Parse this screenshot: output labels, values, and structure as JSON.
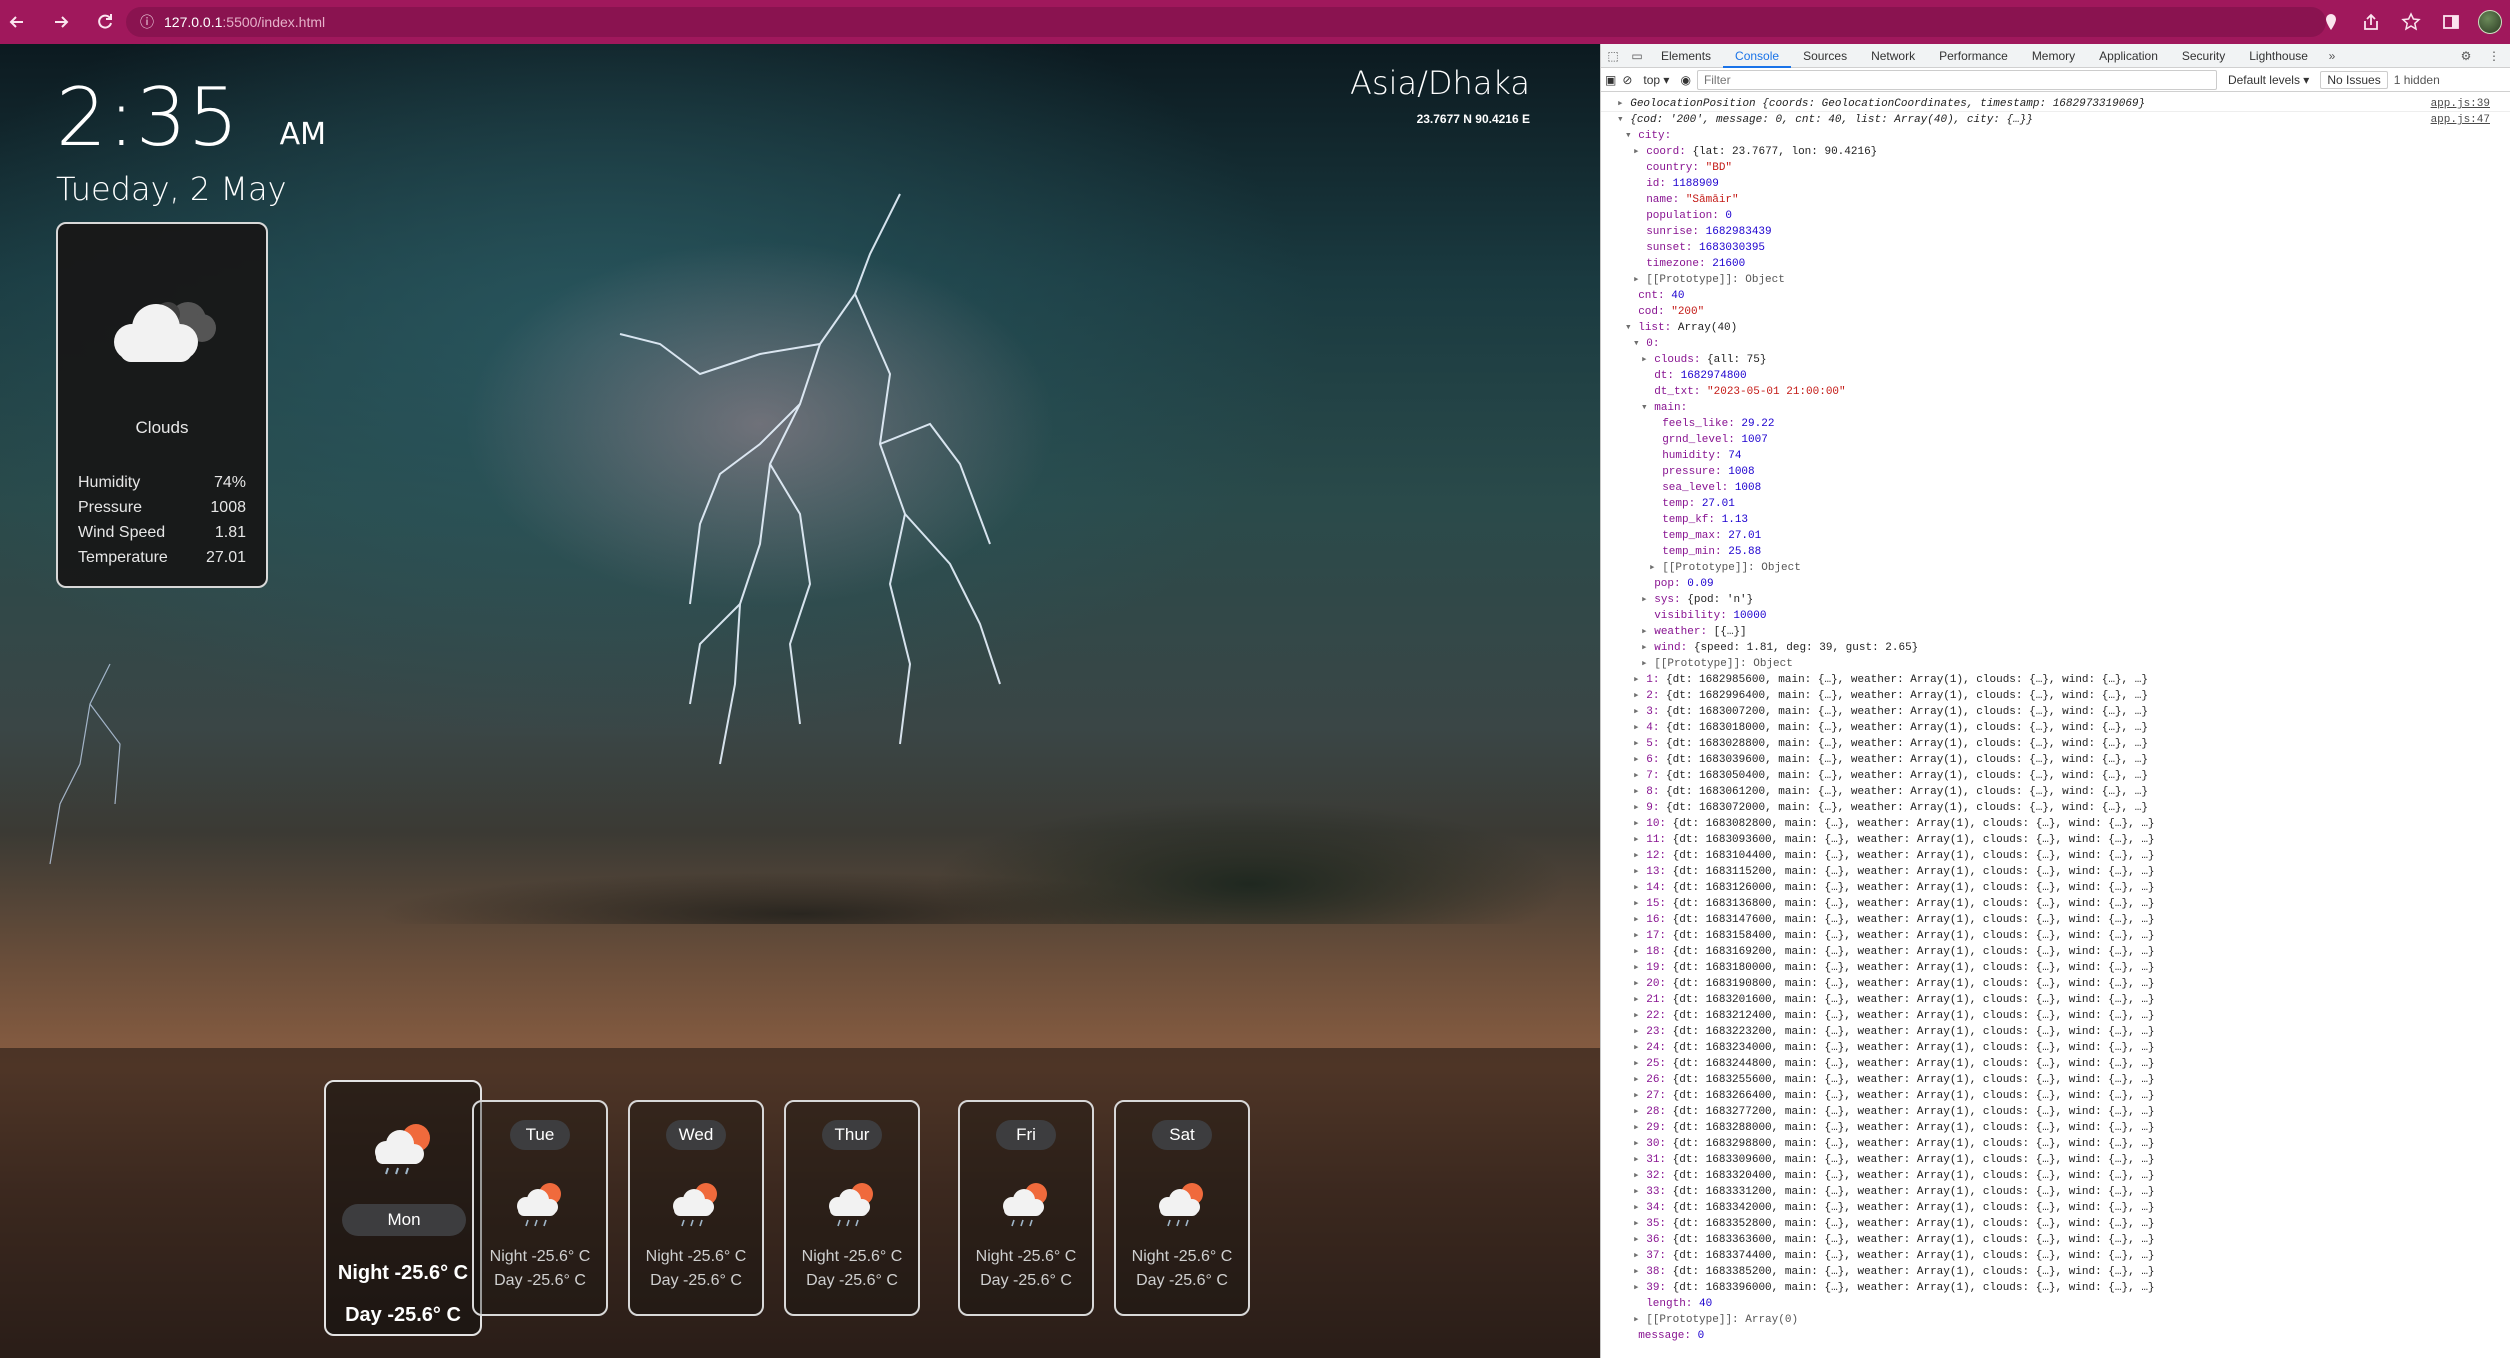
{
  "browser": {
    "url_host": "127.0.0.1",
    "url_path": ":5500/index.html"
  },
  "weather": {
    "time": "2:35",
    "ampm": "AM",
    "date": "Tueday, 2 May",
    "timezone": "Asia/Dhaka",
    "coords": "23.7677 N 90.4216 E",
    "current": {
      "condition": "Clouds",
      "stats": [
        {
          "label": "Humidity",
          "value": "74%"
        },
        {
          "label": "Pressure",
          "value": "1008"
        },
        {
          "label": "Wind Speed",
          "value": "1.81"
        },
        {
          "label": "Temperature",
          "value": "27.01"
        }
      ]
    },
    "today": {
      "day": "Mon",
      "night": "Night -25.6° C",
      "dayt": "Day -25.6° C"
    },
    "forecast": [
      {
        "day": "Tue",
        "night": "Night -25.6° C",
        "dayt": "Day -25.6° C"
      },
      {
        "day": "Wed",
        "night": "Night -25.6° C",
        "dayt": "Day -25.6° C"
      },
      {
        "day": "Thur",
        "night": "Night -25.6° C",
        "dayt": "Day -25.6° C"
      },
      {
        "day": "Fri",
        "night": "Night -25.6° C",
        "dayt": "Day -25.6° C"
      },
      {
        "day": "Sat",
        "night": "Night -25.6° C",
        "dayt": "Day -25.6° C"
      }
    ]
  },
  "devtools": {
    "tabs": [
      "Elements",
      "Console",
      "Sources",
      "Network",
      "Performance",
      "Memory",
      "Application",
      "Security",
      "Lighthouse"
    ],
    "active_tab": "Console",
    "context": "top ▾",
    "filter_placeholder": "Filter",
    "levels": "Default levels ▾",
    "issues": "No Issues",
    "hidden": "1 hidden",
    "lines": [
      {
        "indent": 1,
        "arrow": "▸",
        "text": "GeolocationPosition {coords: GeolocationCoordinates, timestamp: 1682973319069}",
        "src": "app.js:39",
        "italic": true
      },
      {
        "indent": 1,
        "arrow": "▾",
        "text": "{cod: '200', message: 0, cnt: 40, list: Array(40), city: {…}}",
        "src": "app.js:47",
        "italic": true
      },
      {
        "indent": 2,
        "arrow": "▾",
        "key": "city",
        "text": ""
      },
      {
        "indent": 3,
        "arrow": "▸",
        "key": "coord",
        "text": "{lat: 23.7677, lon: 90.4216}"
      },
      {
        "indent": 3,
        "key": "country",
        "str": "\"BD\""
      },
      {
        "indent": 3,
        "key": "id",
        "num": "1188909"
      },
      {
        "indent": 3,
        "key": "name",
        "str": "\"Sāmāir\""
      },
      {
        "indent": 3,
        "key": "population",
        "num": "0"
      },
      {
        "indent": 3,
        "key": "sunrise",
        "num": "1682983439"
      },
      {
        "indent": 3,
        "key": "sunset",
        "num": "1683030395"
      },
      {
        "indent": 3,
        "key": "timezone",
        "num": "21600"
      },
      {
        "indent": 3,
        "arrow": "▸",
        "proto": "[[Prototype]]: Object"
      },
      {
        "indent": 2,
        "key": "cnt",
        "num": "40"
      },
      {
        "indent": 2,
        "key": "cod",
        "str": "\"200\""
      },
      {
        "indent": 2,
        "arrow": "▾",
        "key": "list",
        "text": "Array(40)"
      },
      {
        "indent": 3,
        "arrow": "▾",
        "key": "0",
        "text": ""
      },
      {
        "indent": 4,
        "arrow": "▸",
        "key": "clouds",
        "text": "{all: 75}"
      },
      {
        "indent": 4,
        "key": "dt",
        "num": "1682974800"
      },
      {
        "indent": 4,
        "key": "dt_txt",
        "str": "\"2023-05-01 21:00:00\""
      },
      {
        "indent": 4,
        "arrow": "▾",
        "key": "main",
        "text": ""
      },
      {
        "indent": 5,
        "key": "feels_like",
        "num": "29.22"
      },
      {
        "indent": 5,
        "key": "grnd_level",
        "num": "1007"
      },
      {
        "indent": 5,
        "key": "humidity",
        "num": "74"
      },
      {
        "indent": 5,
        "key": "pressure",
        "num": "1008"
      },
      {
        "indent": 5,
        "key": "sea_level",
        "num": "1008"
      },
      {
        "indent": 5,
        "key": "temp",
        "num": "27.01"
      },
      {
        "indent": 5,
        "key": "temp_kf",
        "num": "1.13"
      },
      {
        "indent": 5,
        "key": "temp_max",
        "num": "27.01"
      },
      {
        "indent": 5,
        "key": "temp_min",
        "num": "25.88"
      },
      {
        "indent": 5,
        "arrow": "▸",
        "proto": "[[Prototype]]: Object"
      },
      {
        "indent": 4,
        "key": "pop",
        "num": "0.09"
      },
      {
        "indent": 4,
        "arrow": "▸",
        "key": "sys",
        "text": "{pod: 'n'}"
      },
      {
        "indent": 4,
        "key": "visibility",
        "num": "10000"
      },
      {
        "indent": 4,
        "arrow": "▸",
        "key": "weather",
        "text": "[{…}]"
      },
      {
        "indent": 4,
        "arrow": "▸",
        "key": "wind",
        "text": "{speed: 1.81, deg: 39, gust: 2.65}"
      },
      {
        "indent": 4,
        "arrow": "▸",
        "proto": "[[Prototype]]: Object"
      },
      {
        "indent": 3,
        "arrow": "▸",
        "key": "1",
        "text": "{dt: 1682985600, main: {…}, weather: Array(1), clouds: {…}, wind: {…}, …}"
      },
      {
        "indent": 3,
        "arrow": "▸",
        "key": "2",
        "text": "{dt: 1682996400, main: {…}, weather: Array(1), clouds: {…}, wind: {…}, …}"
      },
      {
        "indent": 3,
        "arrow": "▸",
        "key": "3",
        "text": "{dt: 1683007200, main: {…}, weather: Array(1), clouds: {…}, wind: {…}, …}"
      },
      {
        "indent": 3,
        "arrow": "▸",
        "key": "4",
        "text": "{dt: 1683018000, main: {…}, weather: Array(1), clouds: {…}, wind: {…}, …}"
      },
      {
        "indent": 3,
        "arrow": "▸",
        "key": "5",
        "text": "{dt: 1683028800, main: {…}, weather: Array(1), clouds: {…}, wind: {…}, …}"
      },
      {
        "indent": 3,
        "arrow": "▸",
        "key": "6",
        "text": "{dt: 1683039600, main: {…}, weather: Array(1), clouds: {…}, wind: {…}, …}"
      },
      {
        "indent": 3,
        "arrow": "▸",
        "key": "7",
        "text": "{dt: 1683050400, main: {…}, weather: Array(1), clouds: {…}, wind: {…}, …}"
      },
      {
        "indent": 3,
        "arrow": "▸",
        "key": "8",
        "text": "{dt: 1683061200, main: {…}, weather: Array(1), clouds: {…}, wind: {…}, …}"
      },
      {
        "indent": 3,
        "arrow": "▸",
        "key": "9",
        "text": "{dt: 1683072000, main: {…}, weather: Array(1), clouds: {…}, wind: {…}, …}"
      },
      {
        "indent": 3,
        "arrow": "▸",
        "key": "10",
        "text": "{dt: 1683082800, main: {…}, weather: Array(1), clouds: {…}, wind: {…}, …}"
      },
      {
        "indent": 3,
        "arrow": "▸",
        "key": "11",
        "text": "{dt: 1683093600, main: {…}, weather: Array(1), clouds: {…}, wind: {…}, …}"
      },
      {
        "indent": 3,
        "arrow": "▸",
        "key": "12",
        "text": "{dt: 1683104400, main: {…}, weather: Array(1), clouds: {…}, wind: {…}, …}"
      },
      {
        "indent": 3,
        "arrow": "▸",
        "key": "13",
        "text": "{dt: 1683115200, main: {…}, weather: Array(1), clouds: {…}, wind: {…}, …}"
      },
      {
        "indent": 3,
        "arrow": "▸",
        "key": "14",
        "text": "{dt: 1683126000, main: {…}, weather: Array(1), clouds: {…}, wind: {…}, …}"
      },
      {
        "indent": 3,
        "arrow": "▸",
        "key": "15",
        "text": "{dt: 1683136800, main: {…}, weather: Array(1), clouds: {…}, wind: {…}, …}"
      },
      {
        "indent": 3,
        "arrow": "▸",
        "key": "16",
        "text": "{dt: 1683147600, main: {…}, weather: Array(1), clouds: {…}, wind: {…}, …}"
      },
      {
        "indent": 3,
        "arrow": "▸",
        "key": "17",
        "text": "{dt: 1683158400, main: {…}, weather: Array(1), clouds: {…}, wind: {…}, …}"
      },
      {
        "indent": 3,
        "arrow": "▸",
        "key": "18",
        "text": "{dt: 1683169200, main: {…}, weather: Array(1), clouds: {…}, wind: {…}, …}"
      },
      {
        "indent": 3,
        "arrow": "▸",
        "key": "19",
        "text": "{dt: 1683180000, main: {…}, weather: Array(1), clouds: {…}, wind: {…}, …}"
      },
      {
        "indent": 3,
        "arrow": "▸",
        "key": "20",
        "text": "{dt: 1683190800, main: {…}, weather: Array(1), clouds: {…}, wind: {…}, …}"
      },
      {
        "indent": 3,
        "arrow": "▸",
        "key": "21",
        "text": "{dt: 1683201600, main: {…}, weather: Array(1), clouds: {…}, wind: {…}, …}"
      },
      {
        "indent": 3,
        "arrow": "▸",
        "key": "22",
        "text": "{dt: 1683212400, main: {…}, weather: Array(1), clouds: {…}, wind: {…}, …}"
      },
      {
        "indent": 3,
        "arrow": "▸",
        "key": "23",
        "text": "{dt: 1683223200, main: {…}, weather: Array(1), clouds: {…}, wind: {…}, …}"
      },
      {
        "indent": 3,
        "arrow": "▸",
        "key": "24",
        "text": "{dt: 1683234000, main: {…}, weather: Array(1), clouds: {…}, wind: {…}, …}"
      },
      {
        "indent": 3,
        "arrow": "▸",
        "key": "25",
        "text": "{dt: 1683244800, main: {…}, weather: Array(1), clouds: {…}, wind: {…}, …}"
      },
      {
        "indent": 3,
        "arrow": "▸",
        "key": "26",
        "text": "{dt: 1683255600, main: {…}, weather: Array(1), clouds: {…}, wind: {…}, …}"
      },
      {
        "indent": 3,
        "arrow": "▸",
        "key": "27",
        "text": "{dt: 1683266400, main: {…}, weather: Array(1), clouds: {…}, wind: {…}, …}"
      },
      {
        "indent": 3,
        "arrow": "▸",
        "key": "28",
        "text": "{dt: 1683277200, main: {…}, weather: Array(1), clouds: {…}, wind: {…}, …}"
      },
      {
        "indent": 3,
        "arrow": "▸",
        "key": "29",
        "text": "{dt: 1683288000, main: {…}, weather: Array(1), clouds: {…}, wind: {…}, …}"
      },
      {
        "indent": 3,
        "arrow": "▸",
        "key": "30",
        "text": "{dt: 1683298800, main: {…}, weather: Array(1), clouds: {…}, wind: {…}, …}"
      },
      {
        "indent": 3,
        "arrow": "▸",
        "key": "31",
        "text": "{dt: 1683309600, main: {…}, weather: Array(1), clouds: {…}, wind: {…}, …}"
      },
      {
        "indent": 3,
        "arrow": "▸",
        "key": "32",
        "text": "{dt: 1683320400, main: {…}, weather: Array(1), clouds: {…}, wind: {…}, …}"
      },
      {
        "indent": 3,
        "arrow": "▸",
        "key": "33",
        "text": "{dt: 1683331200, main: {…}, weather: Array(1), clouds: {…}, wind: {…}, …}"
      },
      {
        "indent": 3,
        "arrow": "▸",
        "key": "34",
        "text": "{dt: 1683342000, main: {…}, weather: Array(1), clouds: {…}, wind: {…}, …}"
      },
      {
        "indent": 3,
        "arrow": "▸",
        "key": "35",
        "text": "{dt: 1683352800, main: {…}, weather: Array(1), clouds: {…}, wind: {…}, …}"
      },
      {
        "indent": 3,
        "arrow": "▸",
        "key": "36",
        "text": "{dt: 1683363600, main: {…}, weather: Array(1), clouds: {…}, wind: {…}, …}"
      },
      {
        "indent": 3,
        "arrow": "▸",
        "key": "37",
        "text": "{dt: 1683374400, main: {…}, weather: Array(1), clouds: {…}, wind: {…}, …}"
      },
      {
        "indent": 3,
        "arrow": "▸",
        "key": "38",
        "text": "{dt: 1683385200, main: {…}, weather: Array(1), clouds: {…}, wind: {…}, …}"
      },
      {
        "indent": 3,
        "arrow": "▸",
        "key": "39",
        "text": "{dt: 1683396000, main: {…}, weather: Array(1), clouds: {…}, wind: {…}, …}"
      },
      {
        "indent": 3,
        "key": "length",
        "num": "40"
      },
      {
        "indent": 3,
        "arrow": "▸",
        "proto": "[[Prototype]]: Array(0)"
      },
      {
        "indent": 2,
        "key": "message",
        "num": "0"
      }
    ]
  }
}
